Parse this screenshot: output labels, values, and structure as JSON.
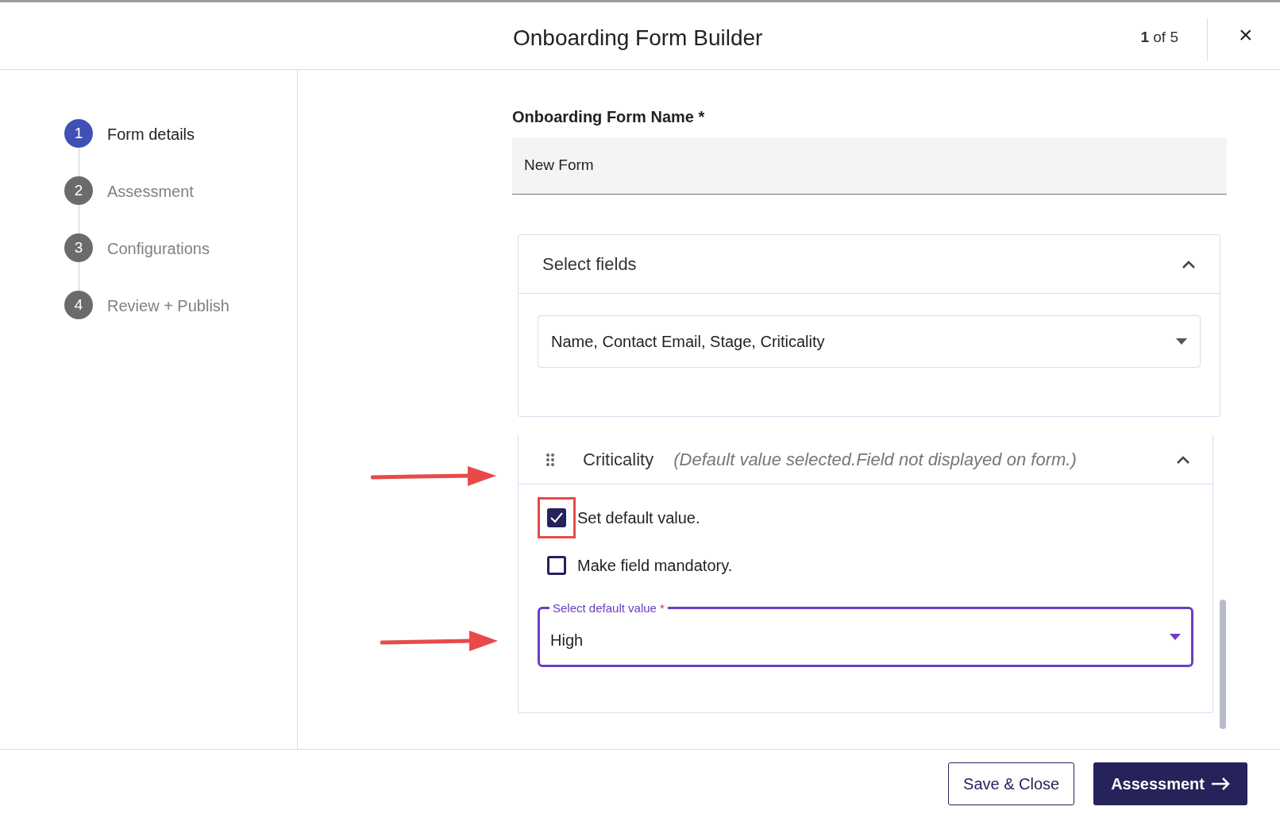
{
  "header": {
    "title": "Onboarding Form Builder",
    "page_current": "1",
    "page_rest": "of 5",
    "close": "×"
  },
  "steps": [
    {
      "number": "1",
      "label": "Form details",
      "selected": true
    },
    {
      "number": "2",
      "label": "Assessment",
      "selected": false
    },
    {
      "number": "3",
      "label": "Configurations",
      "selected": false
    },
    {
      "number": "4",
      "label": "Review + Publish",
      "selected": false
    }
  ],
  "form_name": {
    "label": "Onboarding Form Name *",
    "value": "New Form"
  },
  "select_fields": {
    "title": "Select fields",
    "expanded": true,
    "value": "Name, Contact Email, Stage, Criticality"
  },
  "field_card": {
    "title": "Criticality",
    "note": "(Default value selected.Field not displayed on form.)",
    "expanded": true,
    "options": [
      {
        "label": "Set default value.",
        "checked": true,
        "highlighted": true
      },
      {
        "label": "Make field mandatory.",
        "checked": false,
        "highlighted": false
      }
    ],
    "default_select": {
      "label": "Select default value",
      "required": "*",
      "value": "High"
    }
  },
  "footer": {
    "buttons": [
      {
        "label": "Save & Close",
        "kind": "secondary"
      },
      {
        "label": "Assessment",
        "kind": "primary"
      }
    ]
  }
}
